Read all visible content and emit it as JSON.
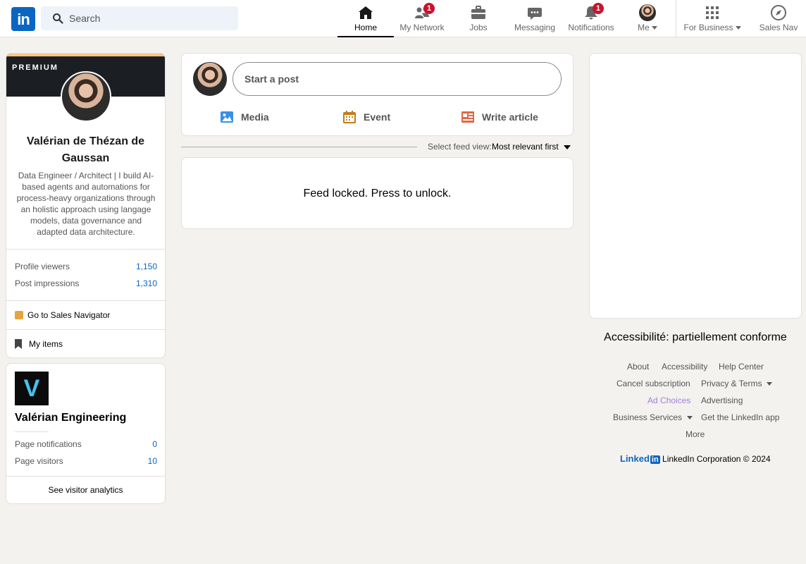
{
  "header": {
    "logo_text": "in",
    "search_placeholder": "Search",
    "nav": [
      {
        "label": "Home",
        "icon": "home-icon",
        "active": true
      },
      {
        "label": "My Network",
        "icon": "network-icon",
        "badge": "1"
      },
      {
        "label": "Jobs",
        "icon": "briefcase-icon"
      },
      {
        "label": "Messaging",
        "icon": "chat-icon"
      },
      {
        "label": "Notifications",
        "icon": "bell-icon",
        "badge": "1"
      },
      {
        "label": "Me",
        "icon": "avatar"
      },
      {
        "label": "For Business",
        "icon": "grid-icon"
      },
      {
        "label": "Sales Nav",
        "icon": "compass-icon"
      }
    ]
  },
  "profile": {
    "premium_label": "PREMIUM",
    "name": "Valérian de Thézan de Gaussan",
    "bio": "Data Engineer / Architect | I build AI-based agents and automations for process-heavy organizations through an holistic approach using langage models, data governance and adapted data architecture.",
    "stats": [
      {
        "label": "Profile viewers",
        "value": "1,150"
      },
      {
        "label": "Post impressions",
        "value": "1,310"
      }
    ],
    "sales_nav_link": "Go to Sales Navigator",
    "my_items": "My items"
  },
  "page": {
    "logo_letter": "V",
    "name": "Valérian Engineering",
    "stats": [
      {
        "label": "Page notifications",
        "value": "0"
      },
      {
        "label": "Page visitors",
        "value": "10"
      }
    ],
    "analytics_link": "See visitor analytics"
  },
  "composer": {
    "placeholder": "Start a post",
    "media": "Media",
    "event": "Event",
    "article": "Write article"
  },
  "feed": {
    "sort_label": "Select feed view:",
    "sort_value": "Most relevant first",
    "locked_message": "Feed locked. Press to unlock."
  },
  "right": {
    "accessibility": "Accessibilité: partiellement conforme",
    "footer_links": {
      "about": "About",
      "accessibility": "Accessibility",
      "help": "Help Center",
      "cancel": "Cancel subscription",
      "privacy": "Privacy & Terms",
      "ad_choices": "Ad Choices",
      "advertising": "Advertising",
      "business": "Business Services",
      "app": "Get the LinkedIn app",
      "more": "More"
    },
    "brand": "Linked",
    "brand_in": "in",
    "copyright": "LinkedIn Corporation © 2024"
  },
  "colors": {
    "brand": "#0a66c2",
    "badge": "#cb112d",
    "premium_gold": "#f8c77e"
  }
}
